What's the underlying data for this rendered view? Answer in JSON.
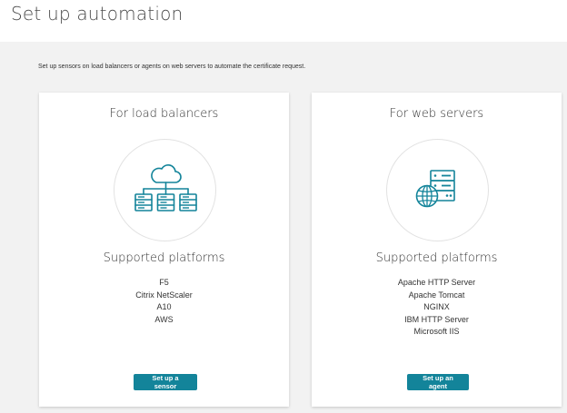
{
  "page": {
    "title": "Set up automation",
    "intro": "Set up sensors on load balancers or agents on web servers to automate the certificate request."
  },
  "theme": {
    "accent": "#13849a",
    "icon_color": "#13849a"
  },
  "cards": [
    {
      "title": "For load balancers",
      "icon": "cloud-network-icon",
      "platforms_title": "Supported platforms",
      "platforms": [
        "F5",
        "Citrix NetScaler",
        "A10",
        "AWS"
      ],
      "button_label": "Set up a sensor"
    },
    {
      "title": "For web servers",
      "icon": "server-globe-icon",
      "platforms_title": "Supported platforms",
      "platforms": [
        "Apache HTTP Server",
        "Apache Tomcat",
        "NGINX",
        "IBM HTTP Server",
        "Microsoft IIS"
      ],
      "button_label": "Set up an agent"
    }
  ]
}
